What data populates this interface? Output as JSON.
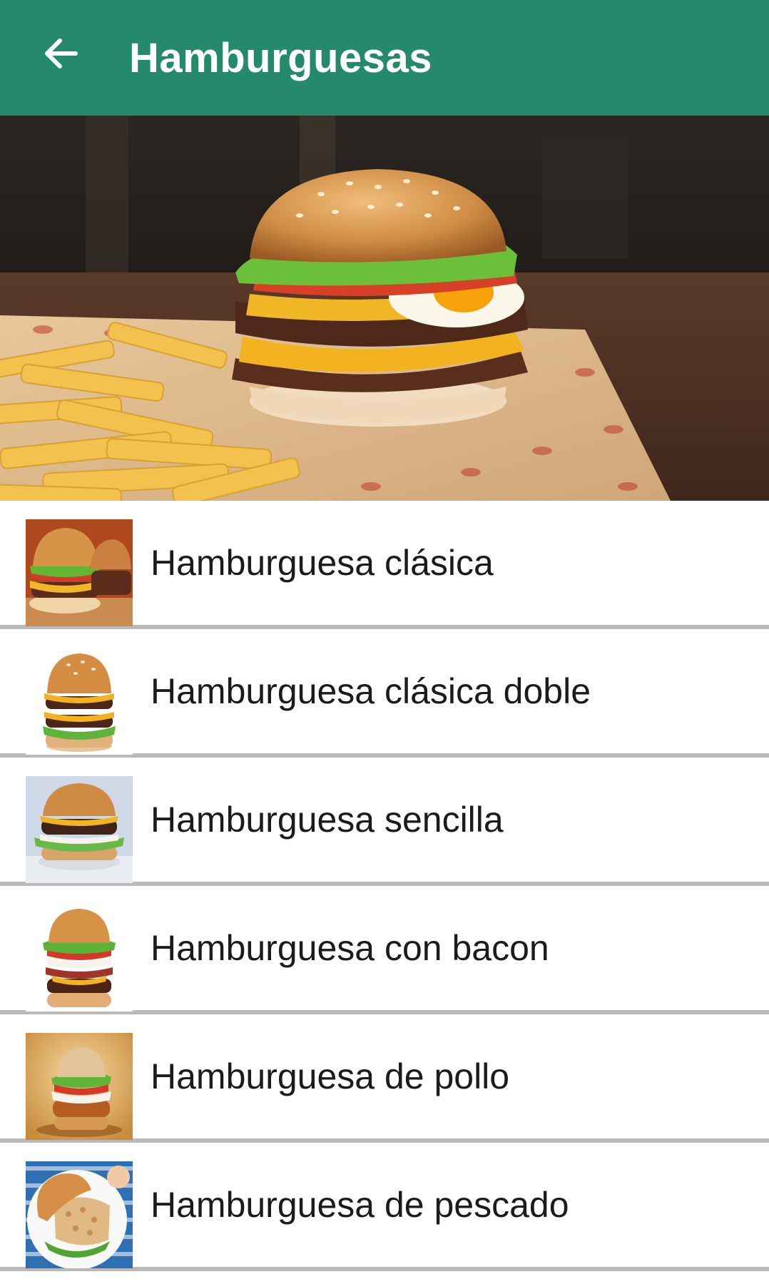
{
  "header": {
    "title": "Hamburguesas",
    "back_icon": "arrow-left-icon",
    "background_color": "#258a6b"
  },
  "hero": {
    "image": "burger-and-fries-photo"
  },
  "items": [
    {
      "label": "Hamburguesa clásica",
      "thumb": "burger-classic-photo"
    },
    {
      "label": "Hamburguesa clásica doble",
      "thumb": "burger-double-photo"
    },
    {
      "label": "Hamburguesa sencilla",
      "thumb": "burger-simple-photo"
    },
    {
      "label": "Hamburguesa con bacon",
      "thumb": "burger-bacon-photo"
    },
    {
      "label": "Hamburguesa de pollo",
      "thumb": "burger-chicken-photo"
    },
    {
      "label": "Hamburguesa de pescado",
      "thumb": "burger-fish-photo"
    }
  ]
}
